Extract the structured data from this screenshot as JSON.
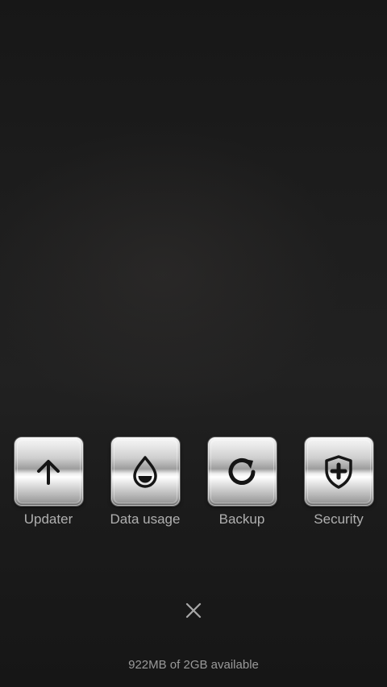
{
  "toolbox": {
    "apps": [
      {
        "label": "Updater",
        "icon": "arrow-up-icon"
      },
      {
        "label": "Data usage",
        "icon": "water-drop-icon"
      },
      {
        "label": "Backup",
        "icon": "refresh-icon"
      },
      {
        "label": "Security",
        "icon": "shield-plus-icon"
      }
    ],
    "close_icon": "close-icon",
    "storage_text": "922MB of 2GB available"
  },
  "colors": {
    "background": "#1c1c1c",
    "label": "#b0b0b0",
    "storage_text": "#9a9a9a",
    "icon": "#1a1a1a"
  }
}
